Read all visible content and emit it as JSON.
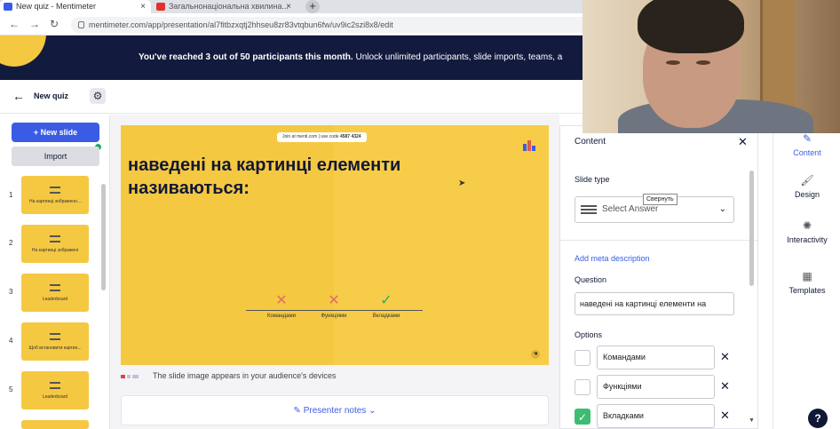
{
  "browser": {
    "tabs": [
      {
        "title": "New quiz - Mentimeter",
        "icon_color": "#3a5ce5"
      },
      {
        "title": "Загальнонаціональна хвилина...",
        "icon_color": "#e0322c"
      }
    ],
    "url": "mentimeter.com/app/presentation/al7fitbzxqtj2hhseu8zr83vtqbun6fw/uv9ic2szi8x8/edit"
  },
  "banner": {
    "bold": "You've reached 3 out of 50 participants this month.",
    "rest": " Unlock unlimited participants, slide imports, teams, a"
  },
  "topbar": {
    "presentation_name": "New quiz"
  },
  "left_panel": {
    "new_slide_label": "+ New slide",
    "import_label": "Import",
    "slides": [
      {
        "num": "1",
        "caption": "На картинці зображено..."
      },
      {
        "num": "2",
        "caption": "На картинці зображені"
      },
      {
        "num": "3",
        "caption": "Leaderboard"
      },
      {
        "num": "4",
        "caption": "Щоб встановити картин..."
      },
      {
        "num": "5",
        "caption": "Leaderboard"
      }
    ]
  },
  "slide": {
    "join_text": "Join at menti.com | use code",
    "join_code": "4587 4324",
    "title": "наведені на картинці елементи називаються:",
    "options": [
      {
        "label": "Командами",
        "mark": "✕",
        "mark_color": "#e0705a"
      },
      {
        "label": "Функціями",
        "mark": "✕",
        "mark_color": "#e0705a"
      },
      {
        "label": "Вкладками",
        "mark": "✓",
        "mark_color": "#2ea864"
      }
    ]
  },
  "hint": "The slide image appears in your audience's devices",
  "presenter_notes": "Presenter notes",
  "content_panel": {
    "header": "Content",
    "slide_type_label": "Slide type",
    "slide_type_value": "Select Answer",
    "tooltip": "Свернуть",
    "meta_link": "Add meta description",
    "question_label": "Question",
    "question_value": "наведені на картинці елементи на",
    "options_label": "Options",
    "options": [
      {
        "value": "Командами",
        "correct": false
      },
      {
        "value": "Функціями",
        "correct": false
      },
      {
        "value": "Вкладками",
        "correct": true
      }
    ]
  },
  "side_tabs": [
    {
      "label": "Content",
      "active": true
    },
    {
      "label": "Design",
      "active": false
    },
    {
      "label": "Interactivity",
      "active": false
    },
    {
      "label": "Templates",
      "active": false
    }
  ],
  "help_label": "?"
}
